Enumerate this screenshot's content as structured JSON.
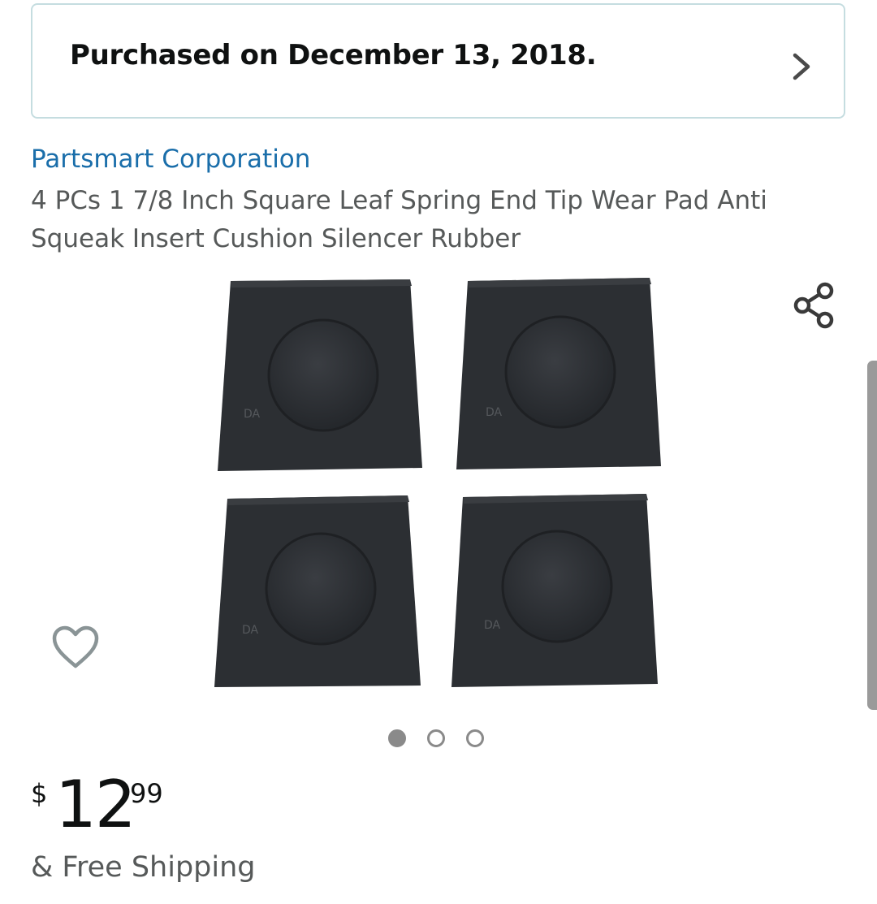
{
  "purchase_banner": {
    "text": "Purchased on December 13, 2018.",
    "chevron_icon": "chevron-right-icon"
  },
  "product": {
    "brand": "Partsmart Corporation",
    "title": "4 PCs 1 7/8 Inch Square Leaf Spring End Tip Wear Pad Anti Squeak Insert Cushion Silencer Rubber",
    "image_description": "four-black-square-rubber-pads",
    "share_icon": "share-icon",
    "wishlist_icon": "heart-outline-icon",
    "gallery": {
      "total_images": 3,
      "active_index": 0
    }
  },
  "price": {
    "symbol": "$",
    "whole": "12",
    "fraction": "99"
  },
  "shipping": {
    "text": "& Free Shipping"
  },
  "colors": {
    "link": "#1a6eaa",
    "banner_border": "#c5dde0",
    "muted_text": "#565959",
    "pad_fill": "#2c2f33"
  }
}
